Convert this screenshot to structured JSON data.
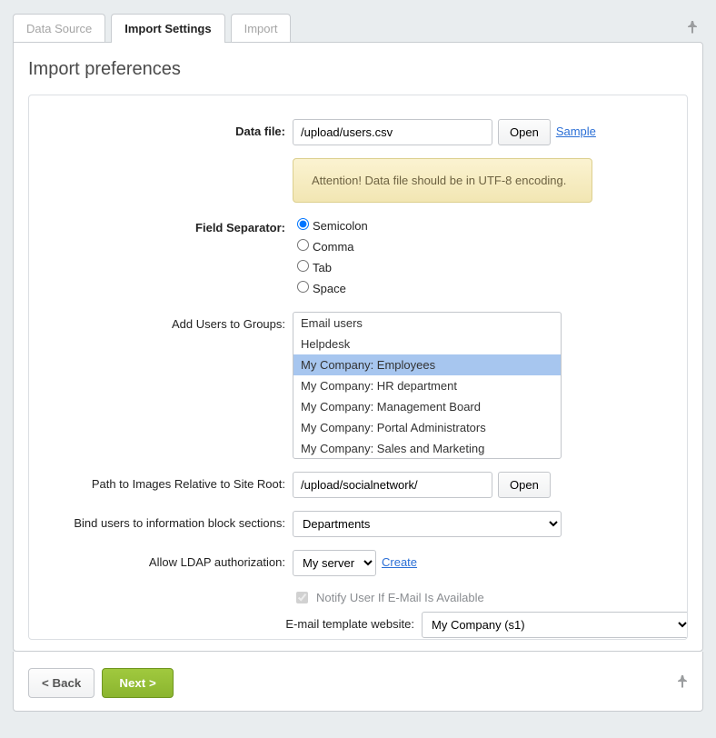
{
  "tabs": [
    "Data Source",
    "Import Settings",
    "Import"
  ],
  "panel_title": "Import preferences",
  "labels": {
    "data_file": "Data file:",
    "field_separator": "Field Separator:",
    "add_users": "Add Users to Groups:",
    "images_path": "Path to Images Relative to Site Root:",
    "bind_sections": "Bind users to information block sections:",
    "allow_ldap": "Allow LDAP authorization:",
    "notify": "Notify User If E-Mail Is Available",
    "email_template": "E-mail template website:"
  },
  "values": {
    "data_file": "/upload/users.csv",
    "images_path": "/upload/socialnetwork/",
    "bind_sections": "Departments",
    "ldap_server": "My server",
    "email_template": "My Company (s1)"
  },
  "buttons": {
    "open": "Open",
    "sample": "Sample",
    "create": "Create",
    "back": "< Back",
    "next": "Next >"
  },
  "notice": "Attention! Data file should be in UTF-8 encoding.",
  "separators": [
    "Semicolon",
    "Comma",
    "Tab",
    "Space"
  ],
  "groups": [
    "Email users",
    "Helpdesk",
    "My Company: Employees",
    "My Company: HR department",
    "My Company: Management Board",
    "My Company: Portal Administrators",
    "My Company: Sales and Marketing"
  ],
  "selected_group_index": 2,
  "ldap_options": [
    "My server"
  ],
  "bind_options": [
    "Departments"
  ],
  "email_options": [
    "My Company (s1)"
  ]
}
